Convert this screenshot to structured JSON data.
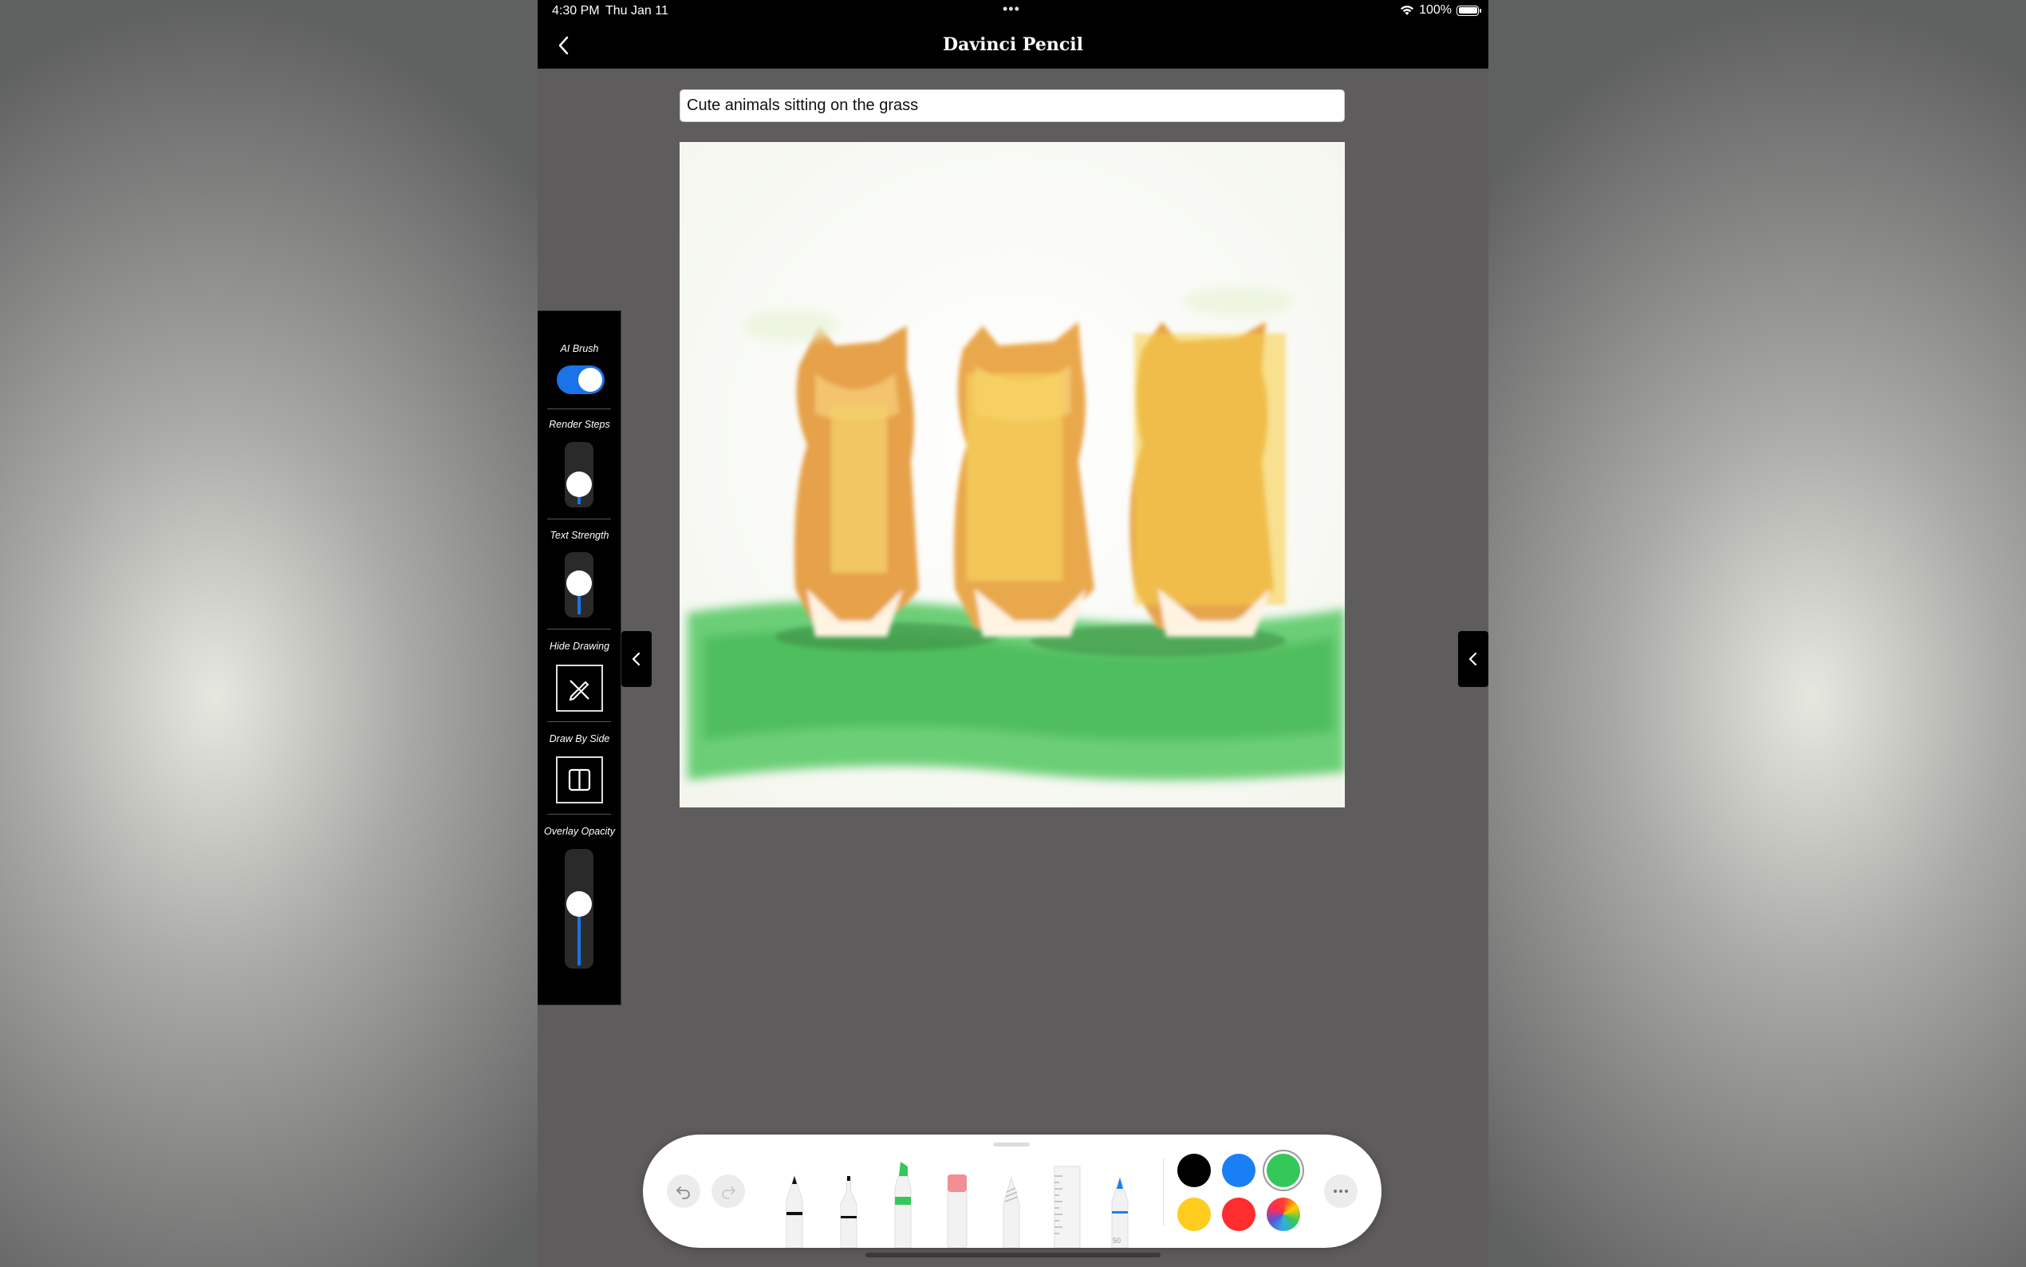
{
  "status_bar": {
    "time": "4:30 PM",
    "date": "Thu Jan 11",
    "battery": "100%"
  },
  "nav": {
    "title": "Davinci Pencil",
    "back_icon": "chevron-left-icon"
  },
  "prompt": {
    "value": "Cute animals sitting on the grass"
  },
  "side_panel": {
    "ai_brush": {
      "label": "AI Brush",
      "on": true
    },
    "render_steps": {
      "label": "Render Steps",
      "level": 0.25
    },
    "text_strength": {
      "label": "Text Strength",
      "level": 0.55
    },
    "hide_drawing": {
      "label": "Hide Drawing",
      "icon": "pencil-slash-icon"
    },
    "draw_by_side": {
      "label": "Draw By Side",
      "icon": "split-view-icon"
    },
    "overlay_opacity": {
      "label": "Overlay Opacity",
      "level": 0.55
    }
  },
  "tool_palette": {
    "undo_icon": "undo-icon",
    "redo_icon": "redo-icon",
    "tools": [
      "pen",
      "fineliner",
      "marker",
      "eraser",
      "pencil",
      "ruler",
      "fountain-pen"
    ],
    "fountain_pen_size_label": "50",
    "colors": [
      "#000000",
      "#1a7ff5",
      "#34c759",
      "#ffcc1f",
      "#ff2d2d",
      "color-wheel"
    ],
    "selected_color": "#34c759"
  },
  "accent_color": "#1a73e8"
}
